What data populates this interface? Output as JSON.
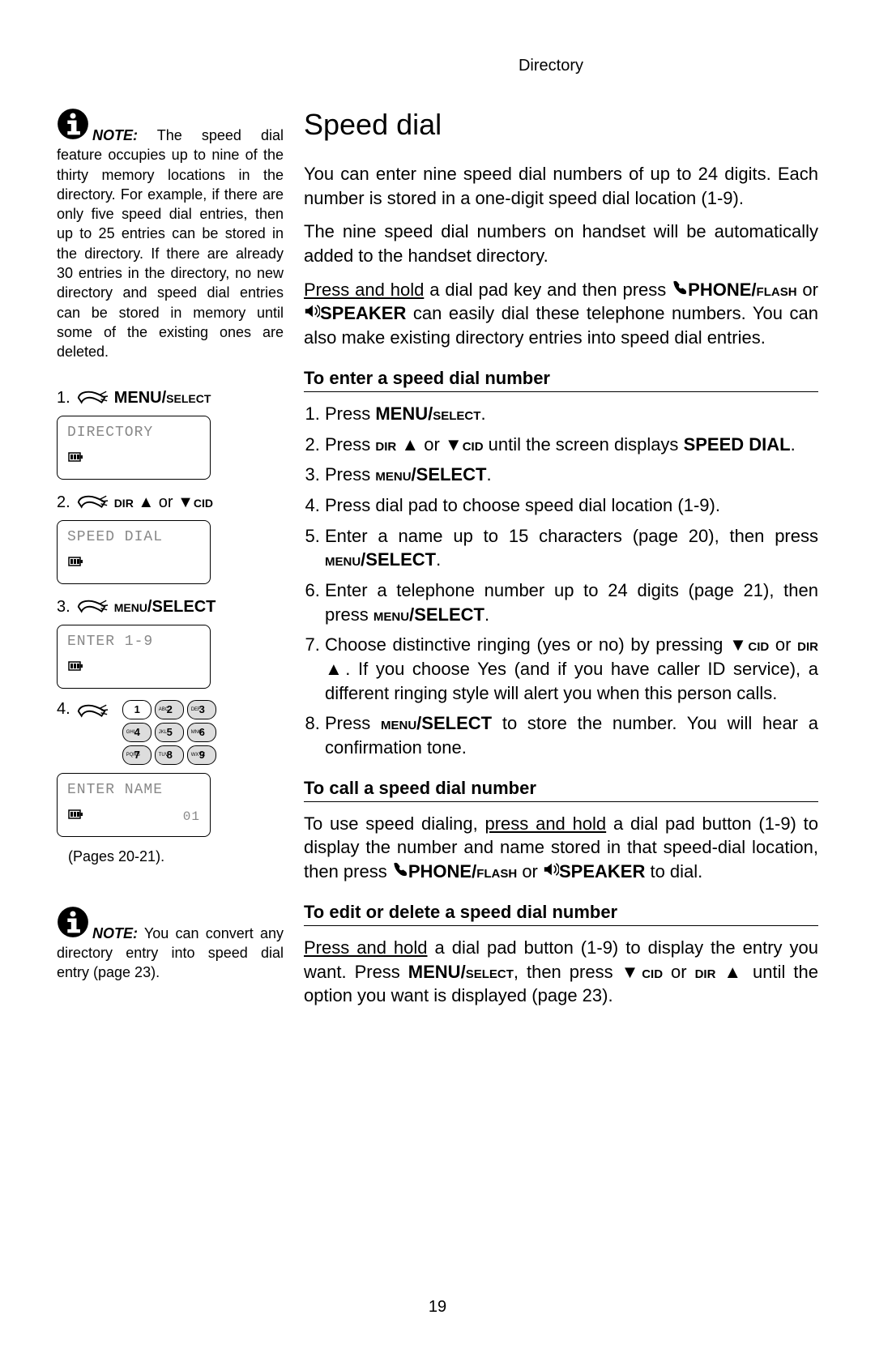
{
  "header": "Directory",
  "title": "Speed dial",
  "page_number": "19",
  "note1_label": "NOTE:",
  "note1_text": " The speed dial feature occupies up to nine of the thirty memory locations in the directory. For example, if there are only five speed dial entries, then up to 25 entries can be stored in the directory. If there are already 30 entries in the directory, no new directory and speed dial entries can be stored in memory until some of the existing ones are deleted.",
  "note2_label": "NOTE:",
  "note2_text": " You can convert any directory entry into speed dial entry (page 23).",
  "intro1": "You can enter nine speed dial numbers of up to 24 digits. Each number is stored in a one-digit speed dial location (1-9).",
  "intro2": "The nine speed dial numbers on handset will be automatically added to the handset directory.",
  "intro3_a": "Press and hold",
  "intro3_b": " a dial pad key and then press ",
  "intro3_phone": "PHONE/",
  "intro3_flash": "flash",
  "intro3_or": " or ",
  "intro3_speaker": "SPEAKER",
  "intro3_c": " can easily dial these telephone numbers. You can also make existing directory entries into speed dial entries.",
  "sub1": "To enter a speed dial number",
  "step1_a": "Press ",
  "step1_b": "MENU/",
  "step1_c": "select",
  "step1_d": ".",
  "step2_a": "Press ",
  "step2_dir": "dir",
  "step2_or": " or ",
  "step2_cid": "cid",
  "step2_b": " until the screen displays ",
  "step2_c": "SPEED DIAL",
  "step2_d": ".",
  "step3_a": "Press ",
  "step3_b": "menu",
  "step3_c": "/SELECT",
  "step3_d": ".",
  "step4": "Press dial pad to choose speed dial location (1-9).",
  "step5_a": "Enter a name up to 15 characters (page 20), then press ",
  "step5_b": "menu",
  "step5_c": "/SELECT",
  "step5_d": ".",
  "step6_a": "Enter a telephone number up to 24 digits (page 21), then press ",
  "step6_b": "menu",
  "step6_c": "/SELECT",
  "step6_d": ".",
  "step7_a": "Choose distinctive ringing (yes or no) by pressing ",
  "step7_cid": "cid",
  "step7_or": " or ",
  "step7_dir": "dir",
  "step7_b": ". If you choose Yes (and if you have caller ID service), a different ringing style will alert you when this person calls.",
  "step8_a": "Press ",
  "step8_b": "menu",
  "step8_c": "/SELECT",
  "step8_d": " to store the number. You will hear a confirmation tone.",
  "sub2": "To call a speed dial number",
  "call_a": "To use speed dialing, ",
  "call_b": "press and hold",
  "call_c": " a dial pad button (1-9) to display the number and name stored in that speed-dial location, then press ",
  "call_phone": "PHONE/",
  "call_flash": "flash",
  "call_or": " or ",
  "call_speaker": "SPEAKER",
  "call_d": " to dial.",
  "sub3": "To edit or delete a speed dial number",
  "edit_a": "Press and hold",
  "edit_b": " a dial pad button (1-9) to display the entry you want. Press ",
  "edit_menu": "MENU/",
  "edit_select": "select",
  "edit_c": ", then press ",
  "edit_cid": "cid",
  "edit_or": " or ",
  "edit_dir": "dir",
  "edit_d": " until the option you want is displayed (page 23).",
  "side": {
    "s1_num": "1.",
    "s1_label_a": "MENU/",
    "s1_label_b": "select",
    "lcd1": "DIRECTORY",
    "s2_num": "2.",
    "s2_dir": "dir",
    "s2_or": " or ",
    "s2_cid": "cid",
    "lcd2": "SPEED DIAL",
    "s3_num": "3.",
    "s3_label_a": "menu",
    "s3_label_b": "/SELECT",
    "lcd3": "ENTER 1-9",
    "s4_num": "4.",
    "lcd4": "ENTER NAME",
    "lcd4_num": "01",
    "pages_ref": "(Pages 20-21).",
    "keys": {
      "r1": [
        "1",
        "ABC 2",
        "DEF 3"
      ],
      "r2": [
        "GHI 4",
        "JKL 5",
        "MNO 6"
      ],
      "r3": [
        "PQRS 7",
        "TUV 8",
        "WXYZ 9"
      ]
    }
  }
}
